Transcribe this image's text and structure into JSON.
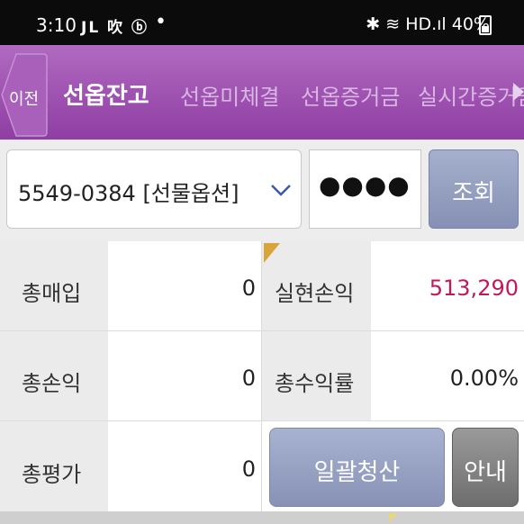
{
  "status_bar": {
    "time": "3:10",
    "left_icons_text": "JL 吹 ⓑ",
    "right_text": "✱ ≋ HD.ıl 40%",
    "battery_percent": 40
  },
  "tabs": {
    "prev_label": "이전",
    "items": [
      {
        "label": "선옵잔고",
        "active": true
      },
      {
        "label": "선옵미체결",
        "active": false
      },
      {
        "label": "선옵증거금",
        "active": false
      },
      {
        "label": "실시간증거금",
        "active": false
      }
    ]
  },
  "account": {
    "selected": "5549-0384 [선물옵션]",
    "password_mask": "●●●●",
    "query_label": "조회"
  },
  "summary": {
    "total_buy_label": "총매입",
    "total_buy_value": "0",
    "realized_pl_label": "실현손익",
    "realized_pl_value": "513,290",
    "total_pl_label": "총손익",
    "total_pl_value": "0",
    "total_return_label": "총수익률",
    "total_return_value": "0.00%",
    "total_eval_label": "총평가",
    "total_eval_value": "0",
    "settle_all_label": "일괄청산",
    "guide_label": "안내"
  },
  "colors": {
    "tab_bar": "#9b4fb0",
    "positive_value": "#c2185b",
    "button_blue": "#8f99bb"
  }
}
